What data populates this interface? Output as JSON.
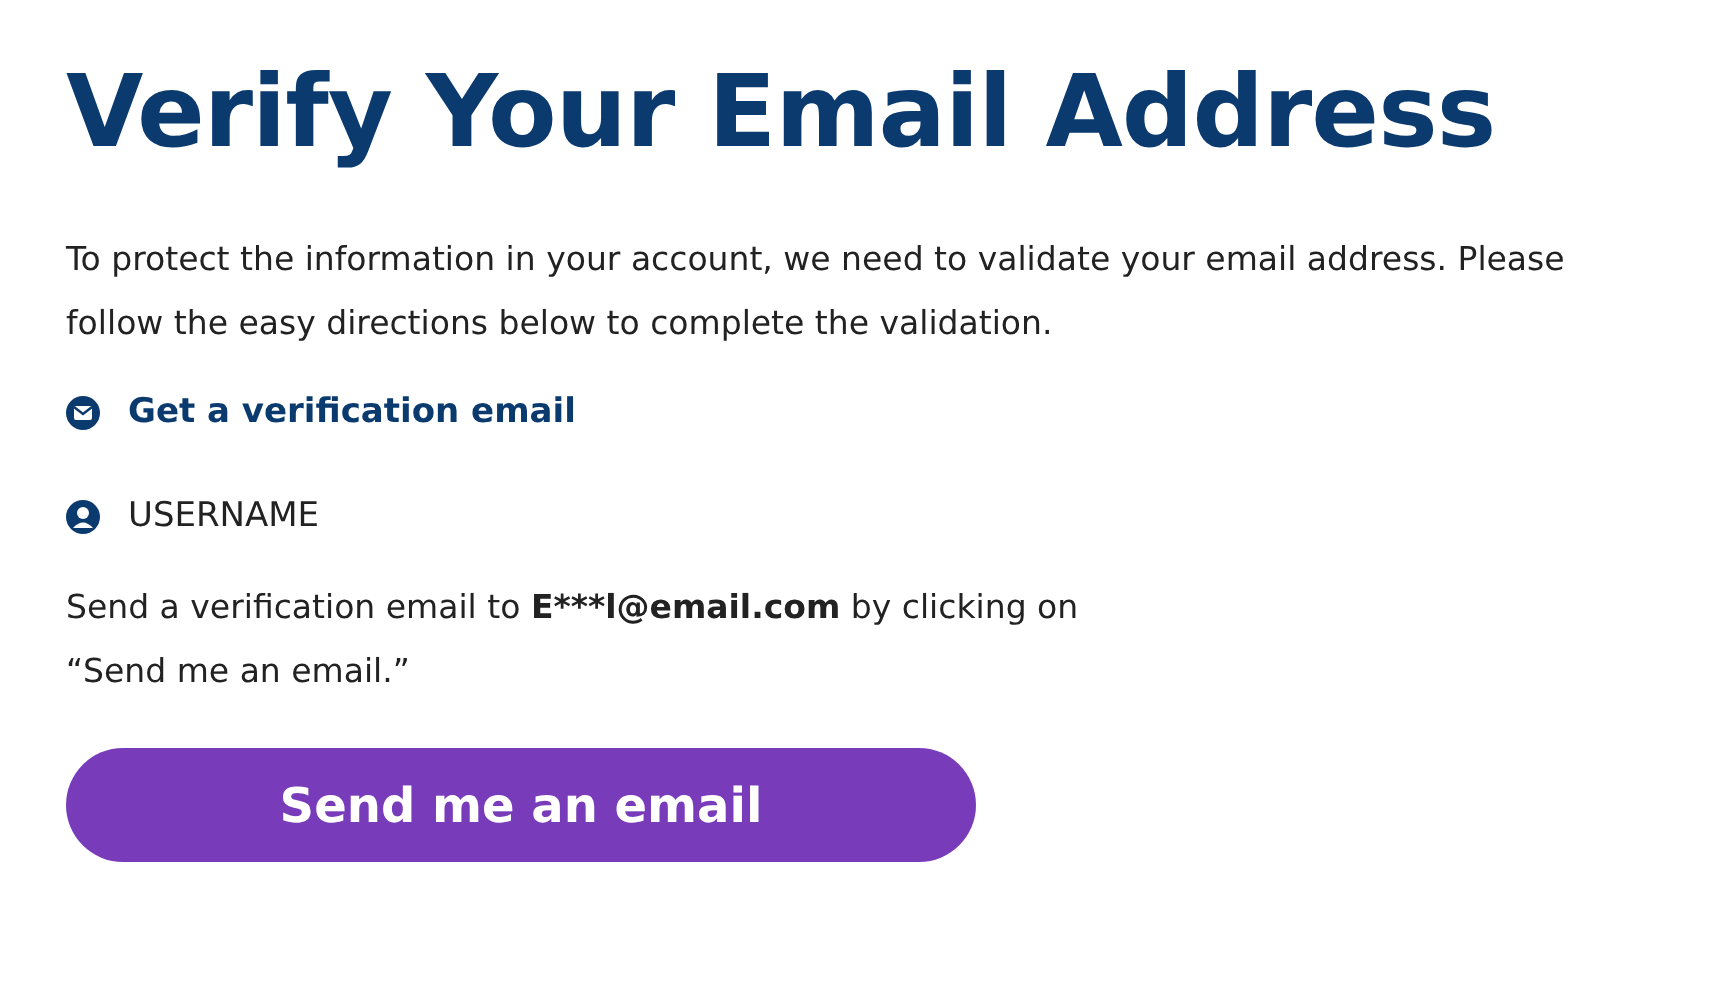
{
  "title": "Verify Your Email Address",
  "intro": "To protect the information in your account, we need to validate your email address. Please follow the easy directions below to complete the validation.",
  "section_heading": "Get a verification email",
  "username": "USERNAME",
  "instruction": {
    "before": "Send a verification email to",
    "email": "E***l@email.com",
    "after": "by clicking on “Send me an email.”"
  },
  "button": "Send me an email"
}
